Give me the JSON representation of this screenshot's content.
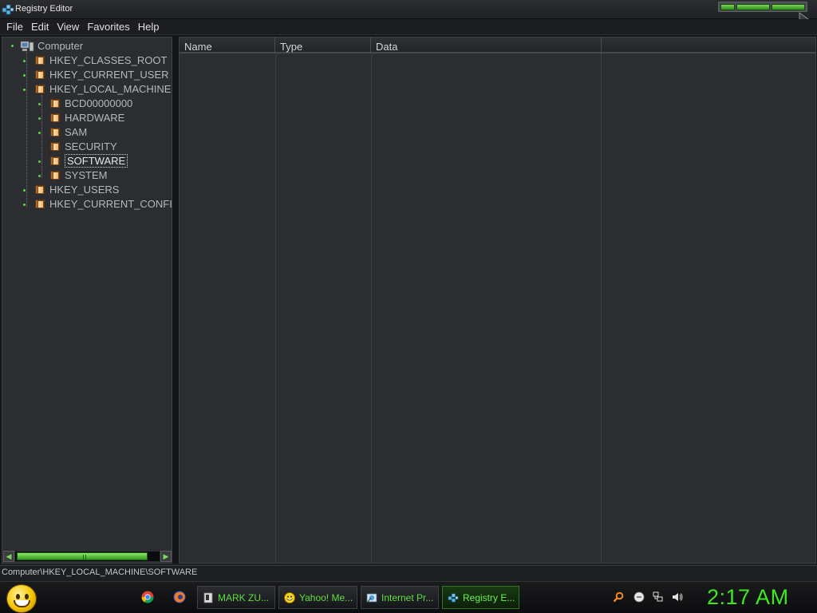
{
  "window": {
    "title": "Registry Editor",
    "title_icon": "registry-editor-icon"
  },
  "menu": {
    "items": [
      "File",
      "Edit",
      "View",
      "Favorites",
      "Help"
    ]
  },
  "tree": {
    "root": {
      "label": "Computer",
      "icon": "computer-icon"
    },
    "hives": [
      {
        "label": "HKEY_CLASSES_ROOT"
      },
      {
        "label": "HKEY_CURRENT_USER"
      },
      {
        "label": "HKEY_LOCAL_MACHINE"
      },
      {
        "label": "HKEY_USERS"
      },
      {
        "label": "HKEY_CURRENT_CONFI"
      }
    ],
    "hklm_children": [
      {
        "label": "BCD00000000"
      },
      {
        "label": "HARDWARE"
      },
      {
        "label": "SAM"
      },
      {
        "label": "SECURITY"
      },
      {
        "label": "SOFTWARE",
        "selected": true
      },
      {
        "label": "SYSTEM"
      }
    ]
  },
  "list": {
    "columns": [
      "Name",
      "Type",
      "Data"
    ]
  },
  "status": {
    "path": "Computer\\HKEY_LOCAL_MACHINE\\SOFTWARE"
  },
  "taskbar": {
    "start_icon": "smiley-start-icon",
    "quick_launch": [
      "chrome-icon",
      "firefox-icon"
    ],
    "buttons": [
      {
        "label": "MARK ZU...",
        "icon": "document-icon"
      },
      {
        "label": "Yahoo! Me...",
        "icon": "yahoo-messenger-icon"
      },
      {
        "label": "Internet Pr...",
        "icon": "internet-properties-icon"
      },
      {
        "label": "Registry E...",
        "icon": "registry-editor-icon",
        "active": true
      }
    ],
    "tray": [
      "search-icon",
      "messenger-icon",
      "network-icon",
      "volume-icon"
    ],
    "clock": "2:17 AM"
  },
  "colors": {
    "accent": "#3fe822",
    "background": "#2b2d30"
  }
}
